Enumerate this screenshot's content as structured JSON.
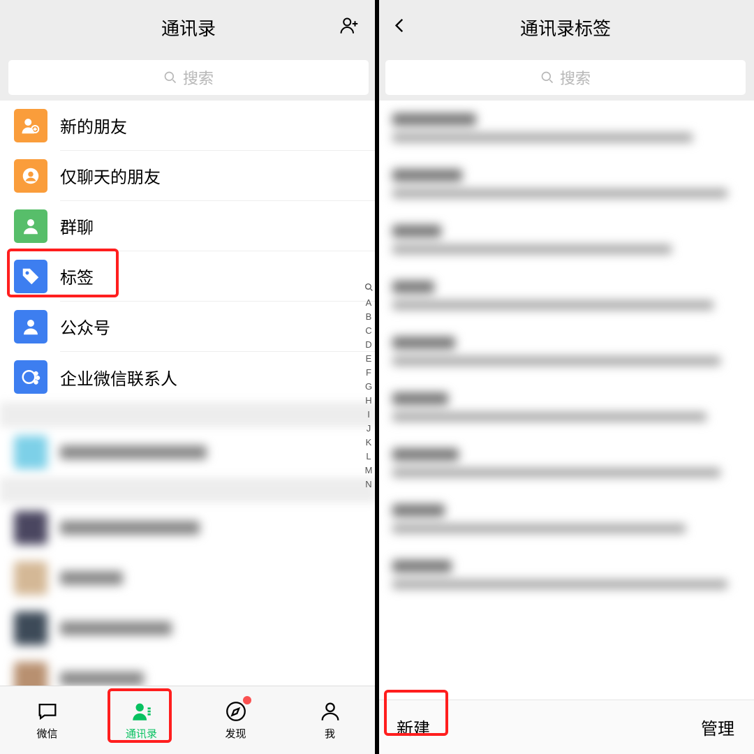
{
  "left": {
    "header_title": "通讯录",
    "search_placeholder": "搜索",
    "rows": [
      {
        "label": "新的朋友",
        "color": "orange",
        "icon": "add-friend"
      },
      {
        "label": "仅聊天的朋友",
        "color": "orange",
        "icon": "chat-friend"
      },
      {
        "label": "群聊",
        "color": "green",
        "icon": "group"
      },
      {
        "label": "标签",
        "color": "blue",
        "icon": "tag"
      },
      {
        "label": "公众号",
        "color": "blue",
        "icon": "official"
      },
      {
        "label": "企业微信联系人",
        "color": "blue",
        "icon": "wecom"
      }
    ],
    "index_letters": [
      "A",
      "B",
      "C",
      "D",
      "E",
      "F",
      "G",
      "H",
      "I",
      "J",
      "K",
      "L",
      "M",
      "N"
    ],
    "tabs": [
      {
        "label": "微信",
        "icon": "chat",
        "active": false,
        "dot": false
      },
      {
        "label": "通讯录",
        "icon": "contacts",
        "active": true,
        "dot": false
      },
      {
        "label": "发现",
        "icon": "discover",
        "active": false,
        "dot": true
      },
      {
        "label": "我",
        "icon": "me",
        "active": false,
        "dot": false
      }
    ]
  },
  "right": {
    "header_title": "通讯录标签",
    "search_placeholder": "搜索",
    "new_label": "新建",
    "manage_label": "管理"
  }
}
